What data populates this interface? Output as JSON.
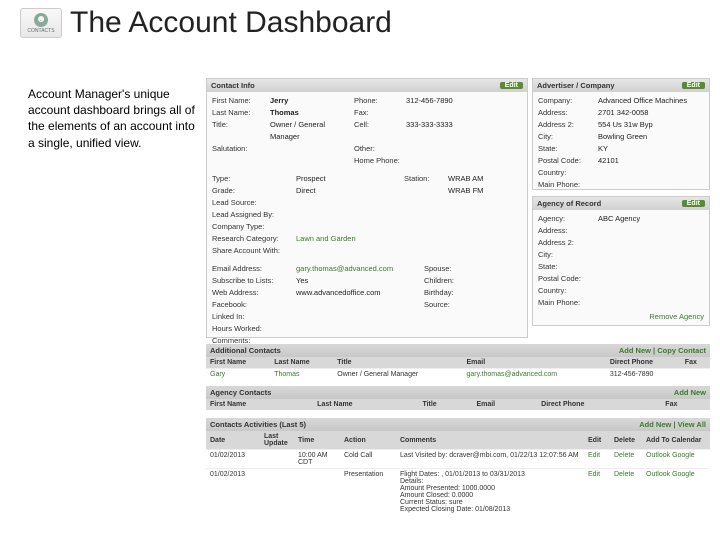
{
  "header": {
    "logo": "CONTACTS",
    "title": "The Account Dashboard"
  },
  "intro": "Account Manager's unique account dashboard brings all of the elements of an account into a single, unified view.",
  "contact_info": {
    "title": "Contact Info",
    "edit": "Edit",
    "first_name_lbl": "First Name:",
    "first_name": "Jerry",
    "last_name_lbl": "Last Name:",
    "last_name": "Thomas",
    "title_lbl": "Title:",
    "title_val": "Owner / General Manager",
    "salutation_lbl": "Salutation:",
    "salutation": "",
    "phone_lbl": "Phone:",
    "phone": "312-456-7890",
    "fax_lbl": "Fax:",
    "fax": "",
    "cell_lbl": "Cell:",
    "cell": "333-333-3333",
    "other_lbl": "Other:",
    "other": "",
    "home_lbl": "Home Phone:",
    "home": "",
    "type_lbl": "Type:",
    "type": "Prospect",
    "station_lbl": "Station:",
    "station1": "WRAB AM",
    "station2": "WRAB FM",
    "grade_lbl": "Grade:",
    "grade": "Direct",
    "lead_lbl": "Lead Source:",
    "lead": "",
    "assigned_lbl": "Lead Assigned By:",
    "assigned": "",
    "ctype_lbl": "Company Type:",
    "ctype": "",
    "rcat_lbl": "Research Category:",
    "rcat": "Lawn and Garden",
    "share_lbl": "Share Account With:",
    "share": "",
    "email_lbl": "Email Address:",
    "email": "gary.thomas@advanced.com",
    "spouse_lbl": "Spouse:",
    "spouse": "",
    "sub_lbl": "Subscribe to Lists:",
    "sub": "Yes",
    "children_lbl": "Children:",
    "children": "",
    "web_lbl": "Web Address:",
    "web": "www.advancedoffice.com",
    "bday_lbl": "Birthday:",
    "bday": "",
    "fb_lbl": "Facebook:",
    "fb": "",
    "src_lbl": "Source:",
    "src": "",
    "li_lbl": "Linked In:",
    "li": "",
    "hours_lbl": "Hours Worked:",
    "hours": "",
    "comments_lbl": "Comments:",
    "comments": ""
  },
  "advertiser": {
    "title": "Advertiser / Company",
    "edit": "Edit",
    "company_lbl": "Company:",
    "company": "Advanced Office Machines",
    "addr_lbl": "Address:",
    "addr": "2701 342-0058",
    "addr2_lbl": "Address 2:",
    "addr2": "554 Us 31w Byp",
    "city_lbl": "City:",
    "city": "Bowling Green",
    "state_lbl": "State:",
    "state": "KY",
    "zip_lbl": "Postal Code:",
    "zip": "42101",
    "country_lbl": "Country:",
    "country": "",
    "mainphone_lbl": "Main Phone:",
    "mainphone": ""
  },
  "agency": {
    "title": "Agency of Record",
    "edit": "Edit",
    "agency_lbl": "Agency:",
    "agency": "ABC Agency",
    "addr_lbl": "Address:",
    "addr": "",
    "addr2_lbl": "Address 2:",
    "addr2": "",
    "city_lbl": "City:",
    "city": "",
    "state_lbl": "State:",
    "state": "",
    "zip_lbl": "Postal Code:",
    "zip": "",
    "country_lbl": "Country:",
    "country": "",
    "mainphone_lbl": "Main Phone:",
    "mainphone": "",
    "remove": "Remove Agency"
  },
  "addl_contacts": {
    "title": "Additional Contacts",
    "addnew": "Add New",
    "copy": "Copy Contact",
    "cols": {
      "fn": "First Name",
      "ln": "Last Name",
      "ti": "Title",
      "em": "Email",
      "dp": "Direct Phone",
      "fx": "Fax"
    },
    "row": {
      "fn": "Gary",
      "ln": "Thomas",
      "ti": "Owner / General Manager",
      "em": "gary.thomas@advanced.com",
      "dp": "312-456-7890",
      "fx": ""
    }
  },
  "agency_contacts": {
    "title": "Agency Contacts",
    "addnew": "Add New",
    "cols": {
      "fn": "First Name",
      "ln": "Last Name",
      "ti": "Title",
      "em": "Email",
      "dp": "Direct Phone",
      "fx": "Fax"
    }
  },
  "activities": {
    "title": "Contacts Activities (Last 5)",
    "addnew": "Add New",
    "viewall": "View All",
    "cols": {
      "date": "Date",
      "lu": "Last Update",
      "time": "Time",
      "act": "Action",
      "com": "Comments",
      "ed": "Edit",
      "del": "Delete",
      "add": "Add To Calendar"
    },
    "rows": [
      {
        "date": "01/02/2013",
        "lu": "",
        "time": "10:00 AM CDT",
        "act": "Cold Call",
        "com": "Last Visited by: dcraver@mbi.com, 01/22/13 12:07:56 AM",
        "ed": "Edit",
        "del": "Delete",
        "o": "Outlook",
        "g": "Google"
      },
      {
        "date": "01/02/2013",
        "lu": "",
        "time": "",
        "act": "Presentation",
        "com": "Flight Dates: , 01/01/2013 to 03/31/2013\nDetails: \nAmount Presented:  1000.0000\nAmount Closed:  0.0000\nCurrent Status:  sure\nExpected Closing Date:  01/08/2013",
        "ed": "Edit",
        "del": "Delete",
        "o": "Outlook",
        "g": "Google"
      }
    ]
  }
}
